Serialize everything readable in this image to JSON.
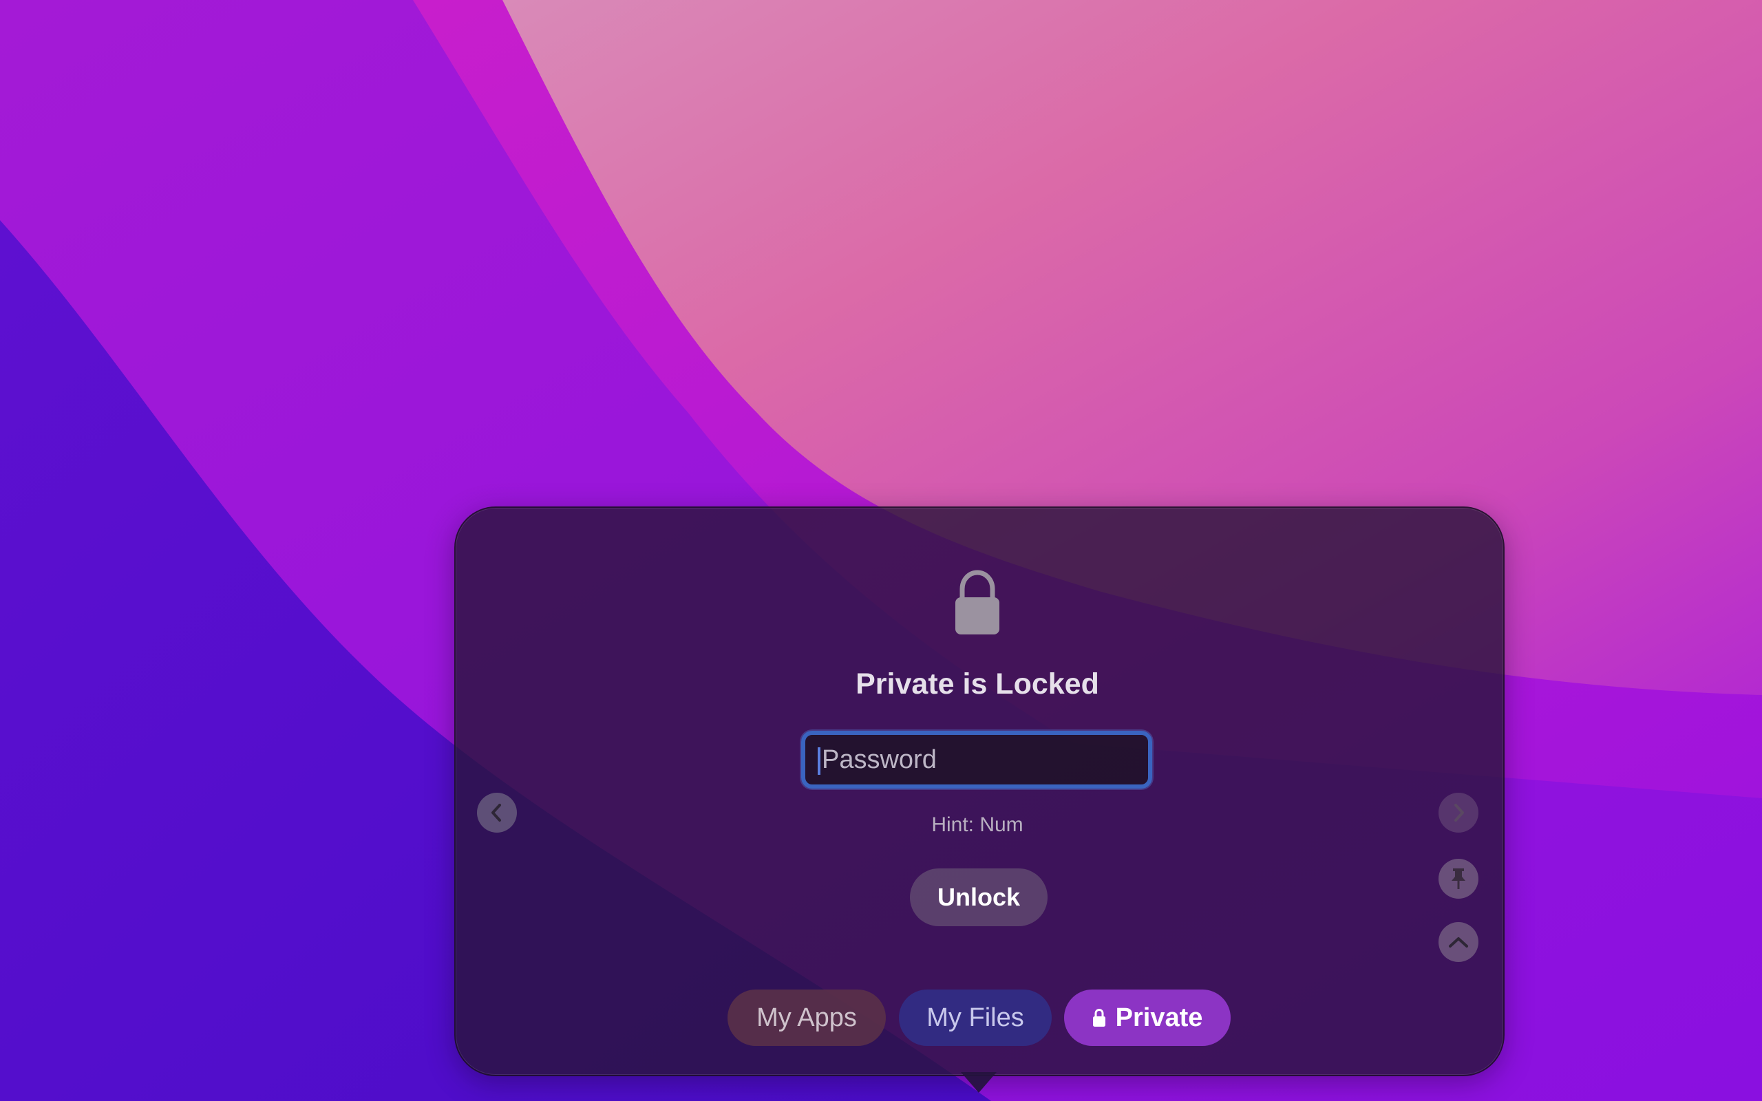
{
  "wallpaper": {
    "colors": {
      "violet": "#5a0fd0",
      "purple": "#9d12d8",
      "magenta": "#c21cd2",
      "pink": "#da66b0",
      "pink_light": "#d98ab8"
    }
  },
  "popover": {
    "lock_icon": "padlock-icon",
    "title": "Private is Locked",
    "password": {
      "placeholder": "Password",
      "value": ""
    },
    "hint": "Hint: Num",
    "unlock_label": "Unlock",
    "nav": {
      "prev_icon": "chevron-left-icon",
      "next_icon": "chevron-right-icon",
      "pin_icon": "pin-icon",
      "collapse_icon": "chevron-up-icon"
    },
    "tabs": [
      {
        "label": "My Apps",
        "color": "#5c3248"
      },
      {
        "label": "My Files",
        "color": "#30308a"
      },
      {
        "label": "Private",
        "color": "#8c34c4",
        "icon": "lock-icon",
        "selected": true
      }
    ],
    "accent_color": "#3a64c0"
  }
}
